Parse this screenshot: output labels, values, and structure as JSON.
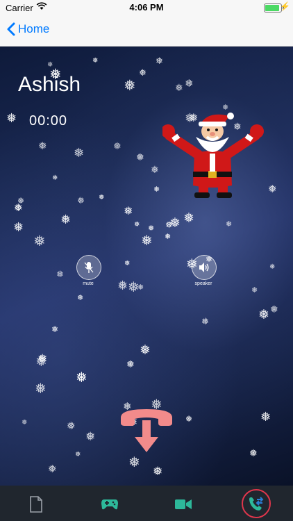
{
  "status": {
    "carrier": "Carrier",
    "time": "4:06 PM"
  },
  "nav": {
    "back_label": "Home"
  },
  "call": {
    "caller_name": "Ashish",
    "duration": "00:00"
  },
  "controls": {
    "mute_label": "mute",
    "speaker_label": "speaker"
  },
  "tabs": [
    {
      "icon": "document-icon"
    },
    {
      "icon": "gamepad-icon"
    },
    {
      "icon": "video-icon"
    },
    {
      "icon": "call-transfer-icon",
      "active": true
    }
  ],
  "colors": {
    "accent": "#007aff",
    "hangup": "#f28b8b",
    "tab_active_ring": "#e0364c",
    "tabbar": "#20262e"
  }
}
